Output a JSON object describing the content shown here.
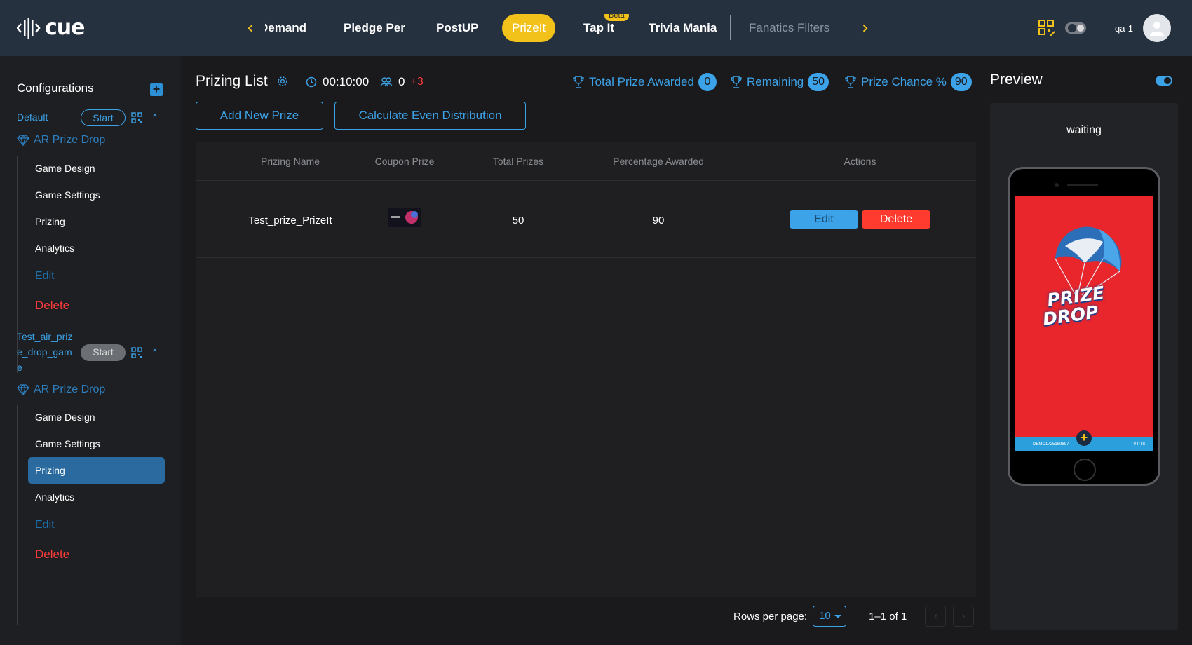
{
  "app": {
    "logo_text": "cue",
    "user_label": "qa-1"
  },
  "nav": {
    "tabs": [
      {
        "label": "Demand"
      },
      {
        "label": "Pledge Per"
      },
      {
        "label": "PostUP"
      },
      {
        "label": "PrizeIt"
      },
      {
        "label": "Tap It",
        "badge": "Beta"
      },
      {
        "label": "Trivia Mania"
      },
      {
        "label": "Fanatics Filters"
      }
    ]
  },
  "sidebar": {
    "title": "Configurations",
    "groups": [
      {
        "name": "Default",
        "start_label": "Start",
        "game_type": "AR Prize Drop",
        "items": [
          "Game Design",
          "Game Settings",
          "Prizing",
          "Analytics",
          "Edit",
          "Delete"
        ]
      },
      {
        "name_lines": [
          "Test_air_priz",
          "e_drop_gam",
          "e"
        ],
        "start_label": "Start",
        "game_type": "AR Prize Drop",
        "items": [
          "Game Design",
          "Game Settings",
          "Prizing",
          "Analytics",
          "Edit",
          "Delete"
        ]
      }
    ]
  },
  "main": {
    "title": "Prizing List",
    "timer": "00:10:00",
    "user_count": "0",
    "user_delta": "+3",
    "stats": [
      {
        "label": "Total Prize Awarded",
        "value": "0"
      },
      {
        "label": "Remaining",
        "value": "50"
      },
      {
        "label": "Prize Chance %",
        "value": "90"
      }
    ],
    "add_button": "Add New Prize",
    "distribute_button": "Calculate Even Distribution",
    "table": {
      "headers": [
        "Prizing Name",
        "Coupon Prize",
        "Total Prizes",
        "Percentage Awarded",
        "Actions"
      ],
      "rows": [
        {
          "name": "Test_prize_PrizeIt",
          "total": "50",
          "percentage": "90",
          "edit": "Edit",
          "delete": "Delete"
        }
      ]
    },
    "pagination": {
      "rows_label": "Rows per page:",
      "rows_value": "10",
      "range": "1–1 of 1"
    }
  },
  "preview": {
    "title": "Preview",
    "status": "waiting",
    "screen_logo_line1": "PRIZE",
    "screen_logo_line2": "DROP",
    "screen_bar_left": "DEMO1725189697",
    "screen_bar_right": "0 PTS."
  },
  "colors": {
    "accent": "#3ca3e8",
    "active_tab": "#f2c21b",
    "danger": "#ff3b30",
    "topbar": "#263140",
    "phone_screen": "#e8262c"
  }
}
